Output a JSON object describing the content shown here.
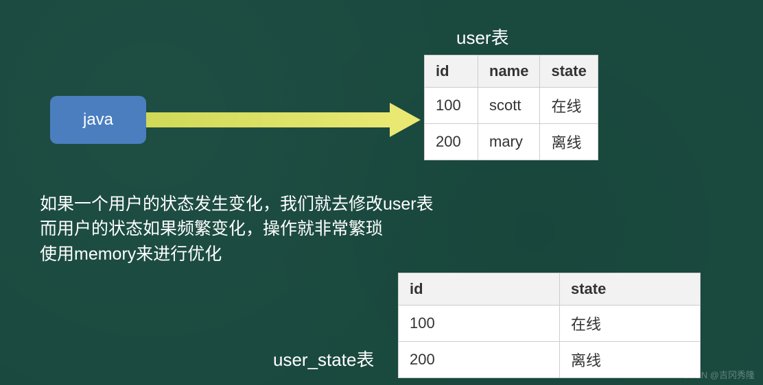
{
  "javaBox": {
    "label": "java"
  },
  "table1": {
    "title": "user表",
    "headers": {
      "id": "id",
      "name": "name",
      "state": "state"
    },
    "rows": [
      {
        "id": "100",
        "name": "scott",
        "state": "在线"
      },
      {
        "id": "200",
        "name": "mary",
        "state": "离线"
      }
    ]
  },
  "description": {
    "line1": "如果一个用户的状态发生变化，我们就去修改user表",
    "line2": "而用户的状态如果频繁变化，操作就非常繁琐",
    "line3": "使用memory来进行优化"
  },
  "table2": {
    "title": "user_state表",
    "headers": {
      "id": "id",
      "state": "state"
    },
    "rows": [
      {
        "id": "100",
        "state": "在线"
      },
      {
        "id": "200",
        "state": "离线"
      }
    ]
  },
  "watermark": "CSDN @吉冈秀隆"
}
